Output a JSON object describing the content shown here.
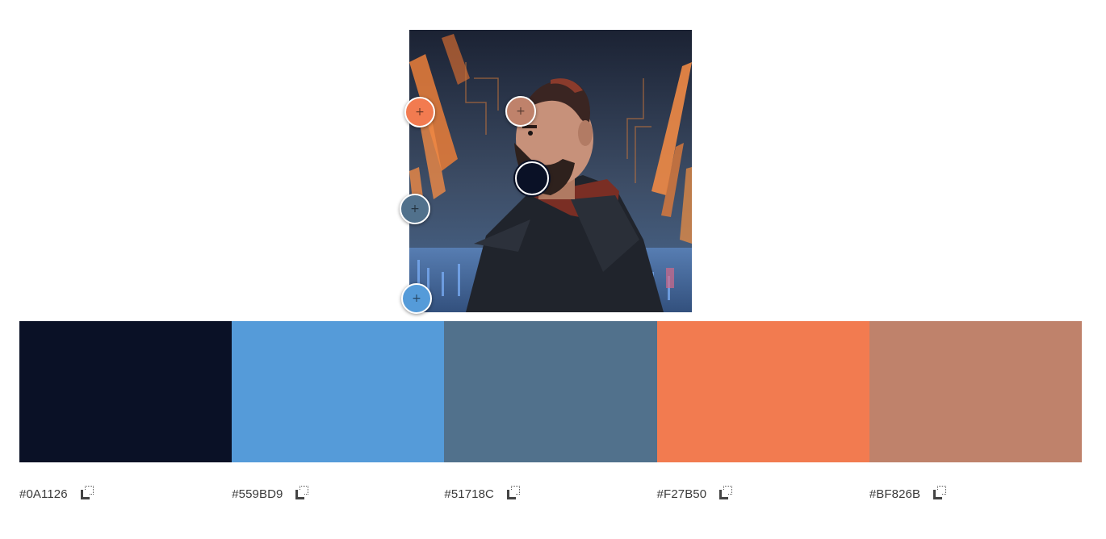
{
  "image": {
    "description_icon": "man-in-neon-corridor-illustration"
  },
  "pickers": [
    {
      "color": "#F27B50",
      "active": false,
      "glyph": "+"
    },
    {
      "color": "#BF826B",
      "active": false,
      "glyph": "+"
    },
    {
      "color": "#0A1126",
      "active": true,
      "glyph": ""
    },
    {
      "color": "#51718C",
      "active": false,
      "glyph": "+"
    },
    {
      "color": "#559BD9",
      "active": false,
      "glyph": "+"
    }
  ],
  "swatches": [
    {
      "hex": "#0A1126",
      "label": "#0A1126"
    },
    {
      "hex": "#559BD9",
      "label": "#559BD9"
    },
    {
      "hex": "#51718C",
      "label": "#51718C"
    },
    {
      "hex": "#F27B50",
      "label": "#F27B50"
    },
    {
      "hex": "#BF826B",
      "label": "#BF826B"
    }
  ],
  "copy_icon": "copy-icon"
}
